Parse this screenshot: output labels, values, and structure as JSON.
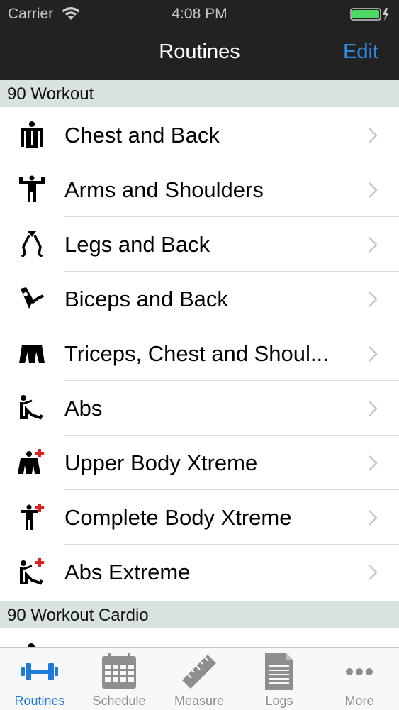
{
  "status_bar": {
    "carrier": "Carrier",
    "time": "4:08 PM"
  },
  "nav": {
    "title": "Routines",
    "edit_label": "Edit"
  },
  "sections": [
    {
      "title": "90 Workout",
      "items": [
        {
          "label": "Chest and Back",
          "icon": "chest-back-icon"
        },
        {
          "label": "Arms and Shoulders",
          "icon": "arms-shoulders-icon"
        },
        {
          "label": "Legs and Back",
          "icon": "legs-back-icon"
        },
        {
          "label": "Biceps and Back",
          "icon": "biceps-back-icon"
        },
        {
          "label": "Triceps, Chest and Shoul...",
          "icon": "triceps-chest-icon"
        },
        {
          "label": "Abs",
          "icon": "abs-icon"
        },
        {
          "label": "Upper Body Xtreme",
          "icon": "upper-body-xtreme-icon"
        },
        {
          "label": "Complete Body Xtreme",
          "icon": "complete-body-xtreme-icon"
        },
        {
          "label": "Abs Extreme",
          "icon": "abs-extreme-icon"
        }
      ]
    },
    {
      "title": "90 Workout Cardio",
      "items": []
    }
  ],
  "tabs": [
    {
      "label": "Routines",
      "icon": "dumbbell-icon",
      "active": true
    },
    {
      "label": "Schedule",
      "icon": "calendar-icon",
      "active": false
    },
    {
      "label": "Measure",
      "icon": "ruler-icon",
      "active": false
    },
    {
      "label": "Logs",
      "icon": "document-icon",
      "active": false
    },
    {
      "label": "More",
      "icon": "more-icon",
      "active": false
    }
  ],
  "colors": {
    "bar_background": "#222222",
    "accent": "#1e7bdc",
    "edit_blue": "#2f8ae6",
    "section_header": "#d8e2de",
    "tab_inactive": "#8e8e8e",
    "red_plus": "#e0201f"
  }
}
